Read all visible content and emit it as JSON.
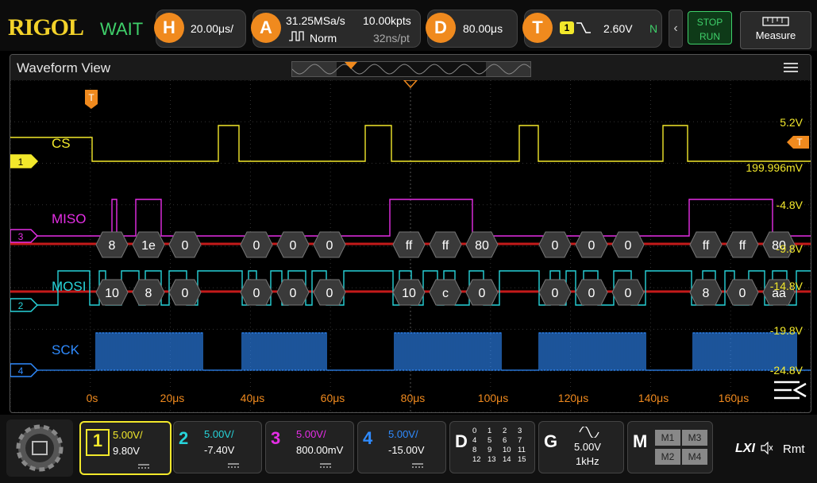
{
  "brand": "RIGOL",
  "state": "WAIT",
  "horizontal": {
    "icon": "H",
    "value": "20.00μs/"
  },
  "acquire": {
    "icon": "A",
    "rate": "31.25MSa/s",
    "mode": "Norm",
    "points": "10.00kpts",
    "per_pt": "32ns/pt"
  },
  "delay": {
    "icon": "D",
    "value": "80.00μs"
  },
  "trigger": {
    "icon": "T",
    "source": "1",
    "level": "2.60V",
    "coupling": "N"
  },
  "runstop": {
    "line1": "STOP",
    "line2": "RUN"
  },
  "measure": "Measure",
  "waveform_view": {
    "title": "Waveform View",
    "trigger_marker": "T"
  },
  "labels": {
    "cs": "CS",
    "miso": "MISO",
    "mosi": "MOSI",
    "sck": "SCK"
  },
  "ch_markers": {
    "ch1": "1",
    "ch2": "2",
    "ch3": "3",
    "ch4": "4",
    "trig": "T"
  },
  "right_scale": [
    "5.2V",
    "199.996mV",
    "-4.8V",
    "-9.8V",
    "-14.8V",
    "-19.8V",
    "-24.8V"
  ],
  "time_ticks": [
    "0s",
    "20μs",
    "40μs",
    "60μs",
    "80μs",
    "100μs",
    "120μs",
    "140μs",
    "160μs"
  ],
  "miso_decode": [
    "8",
    "1e",
    "0",
    "0",
    "0",
    "0",
    "ff",
    "ff",
    "80",
    "0",
    "0",
    "0",
    "ff",
    "ff",
    "80"
  ],
  "mosi_decode": [
    "10",
    "8",
    "0",
    "0",
    "0",
    "0",
    "10",
    "c",
    "0",
    "0",
    "0",
    "0",
    "8",
    "0",
    "aa"
  ],
  "channels": [
    {
      "num": "1",
      "scale": "5.00V/",
      "offset": "9.80V",
      "color": "#f2e82b"
    },
    {
      "num": "2",
      "scale": "5.00V/",
      "offset": "-7.40V",
      "color": "#27d3d9"
    },
    {
      "num": "3",
      "scale": "5.00V/",
      "offset": "800.00mV",
      "color": "#e62ee6"
    },
    {
      "num": "4",
      "scale": "5.00V/",
      "offset": "-15.00V",
      "color": "#2f8bff"
    }
  ],
  "digital": {
    "label": "D",
    "cells": [
      "0",
      "1",
      "2",
      "3",
      "4",
      "5",
      "6",
      "7",
      "8",
      "9",
      "10",
      "11",
      "12",
      "13",
      "14",
      "15"
    ]
  },
  "generator": {
    "label": "G",
    "amp": "5.00V",
    "freq": "1kHz"
  },
  "math": {
    "label": "M",
    "items": [
      "M1",
      "M3",
      "M2",
      "M4"
    ]
  },
  "status": {
    "lxi": "LXI",
    "rmt": "Rmt"
  }
}
